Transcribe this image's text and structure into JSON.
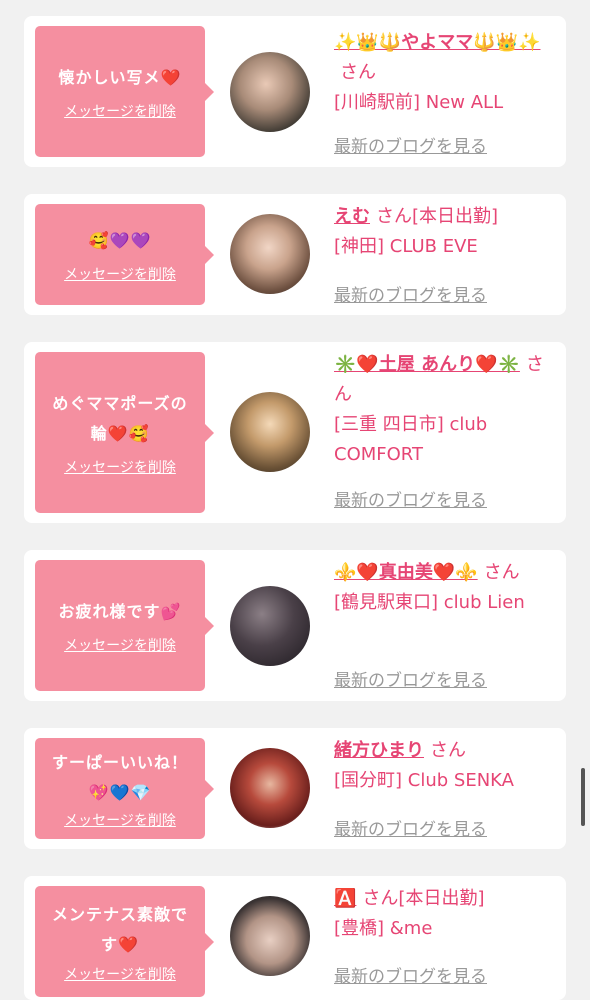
{
  "delete_label": "メッセージを削除",
  "blog_label": "最新のブログを見る",
  "san": "さん",
  "colors": {
    "accent": "#e64574",
    "bubble": "#f58fa0",
    "muted": "#999999"
  },
  "items": [
    {
      "message_l1": "懐かしい写メ❤️",
      "message_l2": "",
      "name": "✨👑🔱やよママ🔱👑✨",
      "status": "",
      "shop": "[川崎駅前] New ALL"
    },
    {
      "message_l1": "🥰💜💜",
      "message_l2": "",
      "name": "えむ",
      "status": "[本日出勤]",
      "shop": "[神田] CLUB EVE"
    },
    {
      "message_l1": "めぐママポーズの",
      "message_l2": "輪❤️🥰",
      "name": "✳️❤️土屋 あんり❤️✳️",
      "status": "",
      "shop": "[三重 四日市] club COMFORT"
    },
    {
      "message_l1": "お疲れ様です💕",
      "message_l2": "",
      "name": "⚜️❤️真由美❤️⚜️",
      "status": "",
      "shop": "[鶴見駅東口] club Lien"
    },
    {
      "message_l1": "すーぱーいいね！",
      "message_l2": "💖💙💎",
      "name": "緒方ひまり",
      "status": "",
      "shop": "[国分町] Club SENKA"
    },
    {
      "message_l1": "メンテナス素敵で",
      "message_l2": "す❤️",
      "name": "🅰️",
      "status": "[本日出勤]",
      "shop": "[豊橋] &me"
    }
  ]
}
